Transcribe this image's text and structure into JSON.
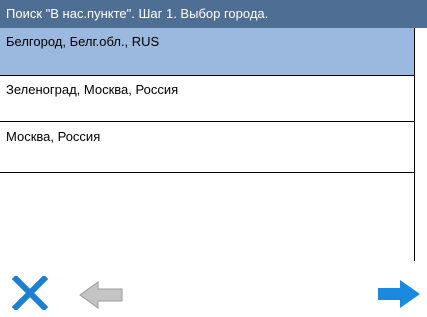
{
  "window": {
    "title": "Поиск \"В нас.пункте\". Шаг 1. Выбор города."
  },
  "list": {
    "items": [
      {
        "label": "Белгород, Белг.обл., RUS",
        "selected": true
      },
      {
        "label": "Зеленоград, Москва, Россия",
        "selected": false
      },
      {
        "label": "Москва, Россия",
        "selected": false
      }
    ]
  },
  "toolbar": {
    "cancel_icon": "close-icon",
    "back_icon": "arrow-left-icon",
    "next_icon": "arrow-right-icon"
  },
  "colors": {
    "titlebar_bg": "#4f6e93",
    "selected_row_bg": "#9bb8df",
    "cancel_blue": "#1d7fd1",
    "next_blue": "#1a8ae0",
    "back_gray": "#b8b8b8"
  }
}
